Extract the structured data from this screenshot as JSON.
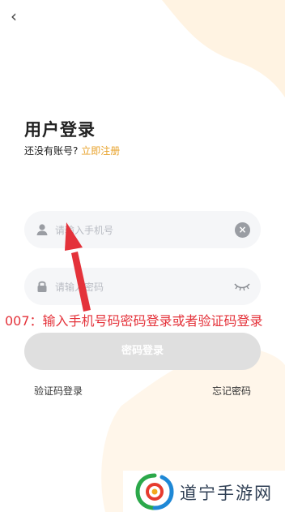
{
  "header": {
    "back_icon": "chevron-left-icon"
  },
  "login": {
    "title": "用户登录",
    "no_account_text": "还没有账号?",
    "register_link": "立即注册",
    "phone_placeholder": "请输入手机号",
    "password_placeholder": "请输入密码",
    "submit_label": "密码登录",
    "code_login_link": "验证码登录",
    "forgot_password_link": "忘记密码"
  },
  "annotation": {
    "text": "007：输入手机号码密码登录或者验证码登录"
  },
  "watermark": {
    "text": "道宁手游网"
  },
  "colors": {
    "accent": "#E8A22A",
    "annotation": "#E4323A",
    "button_disabled": "#DFDFDF",
    "field_bg": "#F5F6F8",
    "blob": "#FFF3E2"
  }
}
